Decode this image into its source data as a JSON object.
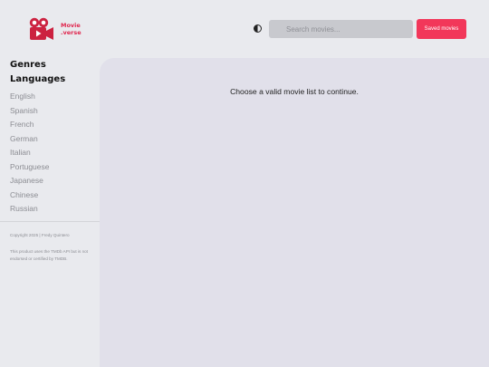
{
  "brand": {
    "line1": "Movie",
    "line2": ".verse",
    "color": "#e0284f"
  },
  "header": {
    "theme_toggle_icon": "half-circle-icon",
    "search_placeholder": "Search movies...",
    "saved_button": "Saved movies",
    "accent": "#f2375a"
  },
  "sidebar": {
    "genres_heading": "Genres",
    "languages_heading": "Languages",
    "languages": [
      "English",
      "Spanish",
      "French",
      "German",
      "Italian",
      "Portuguese",
      "Japanese",
      "Chinese",
      "Russian"
    ],
    "copyright": "Copyright 2025 | Fredy Quintero",
    "disclaimer": "This product uses the TMDb API but is not endorsed or certified by TMDB."
  },
  "main": {
    "message": "Choose a valid movie list to continue."
  }
}
